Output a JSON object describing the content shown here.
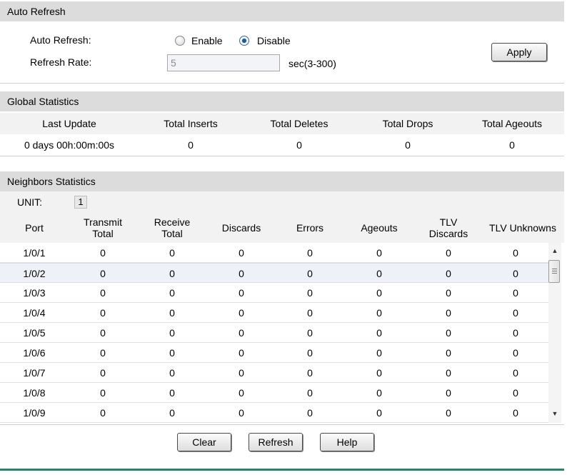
{
  "auto_refresh": {
    "title": "Auto Refresh",
    "auto_refresh_label": "Auto Refresh:",
    "enable_label": "Enable",
    "disable_label": "Disable",
    "selected": "Disable",
    "refresh_rate_label": "Refresh Rate:",
    "refresh_rate_value": "5",
    "refresh_rate_unit": "sec(3-300)",
    "apply_label": "Apply"
  },
  "global_statistics": {
    "title": "Global Statistics",
    "columns": [
      "Last Update",
      "Total Inserts",
      "Total Deletes",
      "Total Drops",
      "Total Ageouts"
    ],
    "row": [
      "0 days 00h:00m:00s",
      "0",
      "0",
      "0",
      "0"
    ]
  },
  "neighbors_statistics": {
    "title": "Neighbors Statistics",
    "unit_label": "UNIT:",
    "unit_value": "1",
    "columns": {
      "port": "Port",
      "transmit_line1": "Transmit",
      "transmit_line2": "Total",
      "receive_line1": "Receive",
      "receive_line2": "Total",
      "discards": "Discards",
      "errors": "Errors",
      "ageouts": "Ageouts",
      "tlv_discards_line1": "TLV",
      "tlv_discards_line2": "Discards",
      "tlv_unknowns": "TLV Unknowns"
    },
    "rows": [
      [
        "1/0/1",
        "0",
        "0",
        "0",
        "0",
        "0",
        "0",
        "0"
      ],
      [
        "1/0/2",
        "0",
        "0",
        "0",
        "0",
        "0",
        "0",
        "0"
      ],
      [
        "1/0/3",
        "0",
        "0",
        "0",
        "0",
        "0",
        "0",
        "0"
      ],
      [
        "1/0/4",
        "0",
        "0",
        "0",
        "0",
        "0",
        "0",
        "0"
      ],
      [
        "1/0/5",
        "0",
        "0",
        "0",
        "0",
        "0",
        "0",
        "0"
      ],
      [
        "1/0/6",
        "0",
        "0",
        "0",
        "0",
        "0",
        "0",
        "0"
      ],
      [
        "1/0/7",
        "0",
        "0",
        "0",
        "0",
        "0",
        "0",
        "0"
      ],
      [
        "1/0/8",
        "0",
        "0",
        "0",
        "0",
        "0",
        "0",
        "0"
      ],
      [
        "1/0/9",
        "0",
        "0",
        "0",
        "0",
        "0",
        "0",
        "0"
      ]
    ],
    "selected_row": 1
  },
  "actions": {
    "clear_label": "Clear",
    "refresh_label": "Refresh",
    "help_label": "Help"
  },
  "colors": {
    "section_header_bg": "#dcdcdc",
    "selected_row_bg": "#eef1f8",
    "footer_line": "#27836e"
  }
}
